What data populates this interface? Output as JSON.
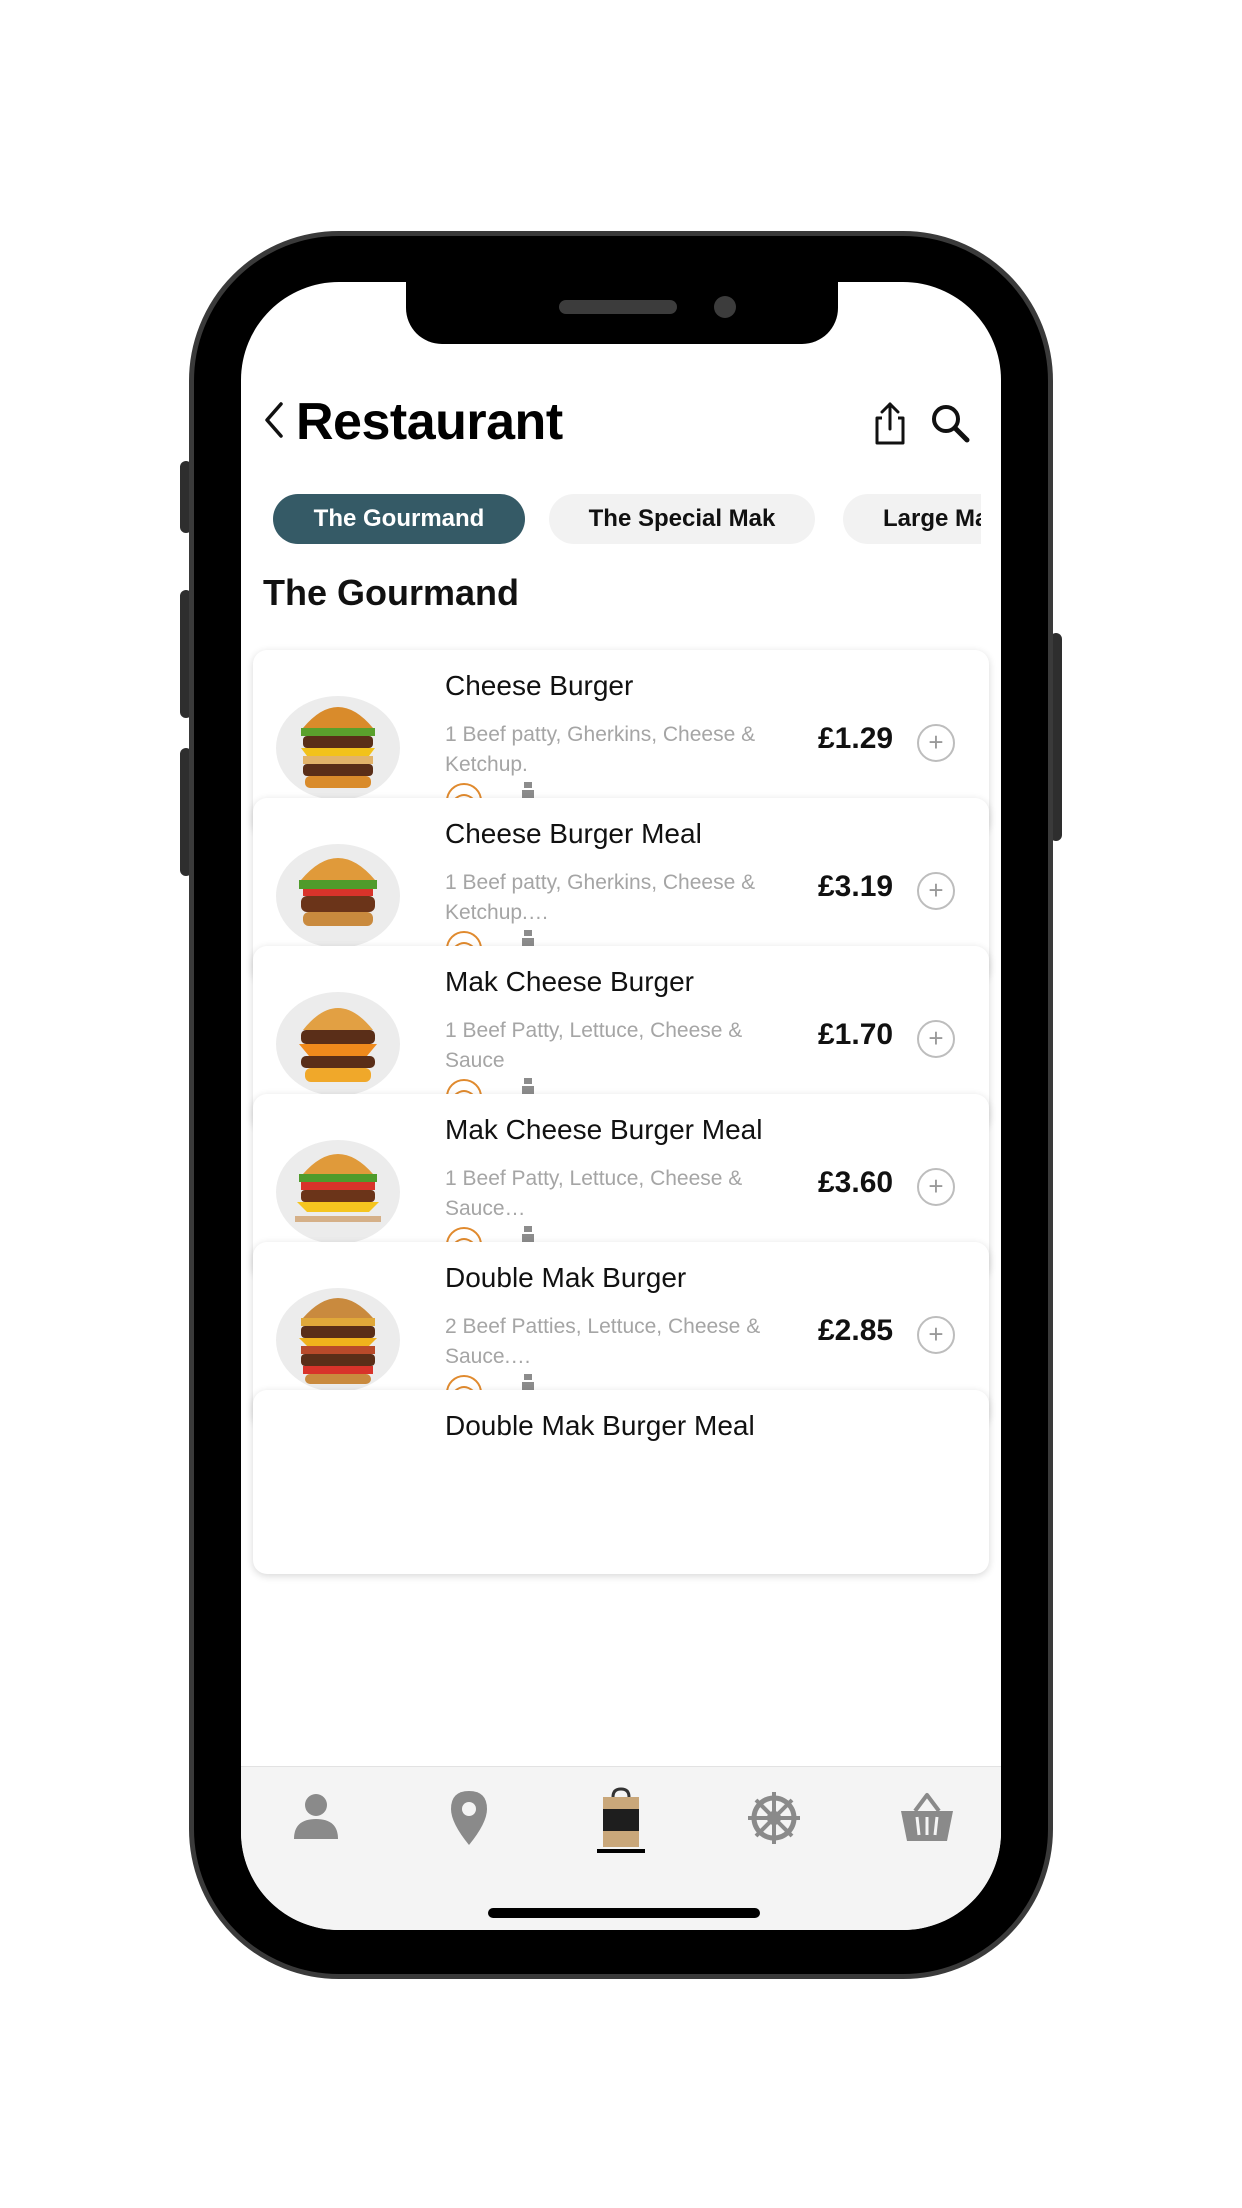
{
  "header": {
    "title": "Restaurant"
  },
  "tabs": [
    {
      "label": "The Gourmand",
      "active": true
    },
    {
      "label": "The Special Mak",
      "active": false
    },
    {
      "label": "Large Ma",
      "active": false
    }
  ],
  "section_title": "The Gourmand",
  "items": [
    {
      "name": "Cheese Burger",
      "desc": "1 Beef patty, Gherkins, Cheese & Ketchup.",
      "price": "£1.29"
    },
    {
      "name": "Cheese Burger Meal",
      "desc": "1 Beef patty, Gherkins, Cheese & Ketchup.…",
      "price": "£3.19"
    },
    {
      "name": "Mak Cheese Burger",
      "desc": "1 Beef Patty, Lettuce, Cheese & Sauce",
      "price": "£1.70"
    },
    {
      "name": "Mak Cheese Burger Meal",
      "desc": "1 Beef Patty, Lettuce, Cheese & Sauce…",
      "price": "£3.60"
    },
    {
      "name": "Double Mak Burger",
      "desc": "2 Beef Patties, Lettuce, Cheese & Sauce.…",
      "price": "£2.85"
    },
    {
      "name": "Double Mak Burger Meal",
      "desc": "",
      "price": ""
    }
  ],
  "add_symbol": "+",
  "nav": {
    "items": [
      "person-icon",
      "location-pin-icon",
      "shopping-bag-icon",
      "settings-wheel-icon",
      "basket-icon"
    ],
    "active": "shopping-bag-icon"
  },
  "colors": {
    "accent": "#355a66",
    "halal": "#e08a2e",
    "muted_text": "#a5a5a5",
    "tab_inactive": "#f2f2f2"
  }
}
